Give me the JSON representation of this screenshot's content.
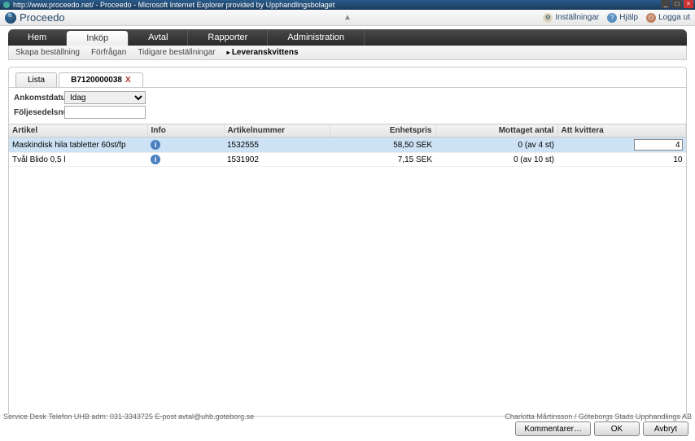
{
  "window": {
    "title": "http://www.proceedo.net/ - Proceedo - Microsoft Internet Explorer provided by Upphandlingsbolaget"
  },
  "brand": "Proceedo",
  "header_center": "▲",
  "header_links": {
    "settings": "Inställningar",
    "help": "Hjälp",
    "logout": "Logga ut"
  },
  "main_nav": {
    "hem": "Hem",
    "inkop": "Inköp",
    "avtal": "Avtal",
    "rapporter": "Rapporter",
    "admin": "Administration"
  },
  "sub_nav": {
    "skapa": "Skapa beställning",
    "forfragan": "Förfrågan",
    "tidigare": "Tidigare beställningar",
    "leverans": "Leveranskvittens"
  },
  "tabs": {
    "lista": "Lista",
    "order": "B7120000038"
  },
  "form": {
    "ankomst_label": "Ankomstdatum",
    "ankomst_value": "Idag",
    "foljesedel_label": "Följesedelsnummer",
    "foljesedel_value": ""
  },
  "table": {
    "headers": {
      "artikel": "Artikel",
      "info": "Info",
      "artikelnr": "Artikelnummer",
      "enhetspris": "Enhetspris",
      "mottaget": "Mottaget antal",
      "att_kvittera": "Att kvittera"
    },
    "rows": [
      {
        "artikel": "Maskindisk hila tabletter 60st/fp",
        "artikelnr": "1532555",
        "enhetspris": "58,50 SEK",
        "mottaget": "0 (av 4 st)",
        "kvittera": "4"
      },
      {
        "artikel": "Tvål Blido 0,5 l",
        "artikelnr": "1531902",
        "enhetspris": "7,15 SEK",
        "mottaget": "0 (av 10 st)",
        "kvittera": "10"
      }
    ]
  },
  "buttons": {
    "kommentarer": "Kommentarer…",
    "ok": "OK",
    "avbryt": "Avbryt"
  },
  "footer": {
    "left": "Service Desk Telefon UHB adm: 031-3343725   E-post avtal@uhb.goteborg.se",
    "right": "Charlotta Mårtinsson / Göteborgs Stads Upphandlings AB"
  }
}
